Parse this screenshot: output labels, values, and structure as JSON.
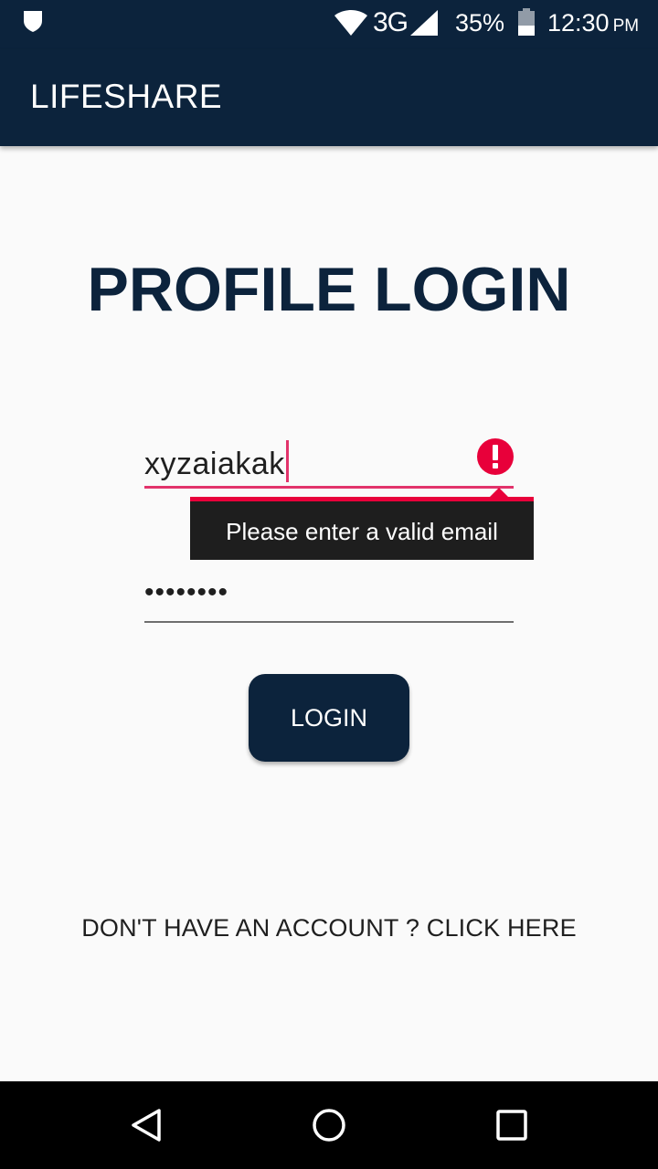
{
  "status_bar": {
    "network": "3G",
    "battery_percent": "35%",
    "time": "12:30",
    "ampm": "PM",
    "icons": [
      "shield-icon",
      "wifi-icon",
      "cell-signal-icon",
      "battery-icon"
    ]
  },
  "app_bar": {
    "title": "LIFESHARE"
  },
  "main": {
    "title": "PROFILE LOGIN",
    "email_value": "xyzaiakak",
    "error_message": "Please enter a valid email",
    "password_value": "••••••••",
    "login_label": "LOGIN",
    "signup_link": "DON'T HAVE AN ACCOUNT ? CLICK HERE"
  },
  "colors": {
    "primary": "#0c233c",
    "error": "#e8003a",
    "field_error_underline": "#e2336b"
  },
  "nav_bar": {
    "icons": [
      "back-icon",
      "home-icon",
      "recents-icon"
    ]
  }
}
